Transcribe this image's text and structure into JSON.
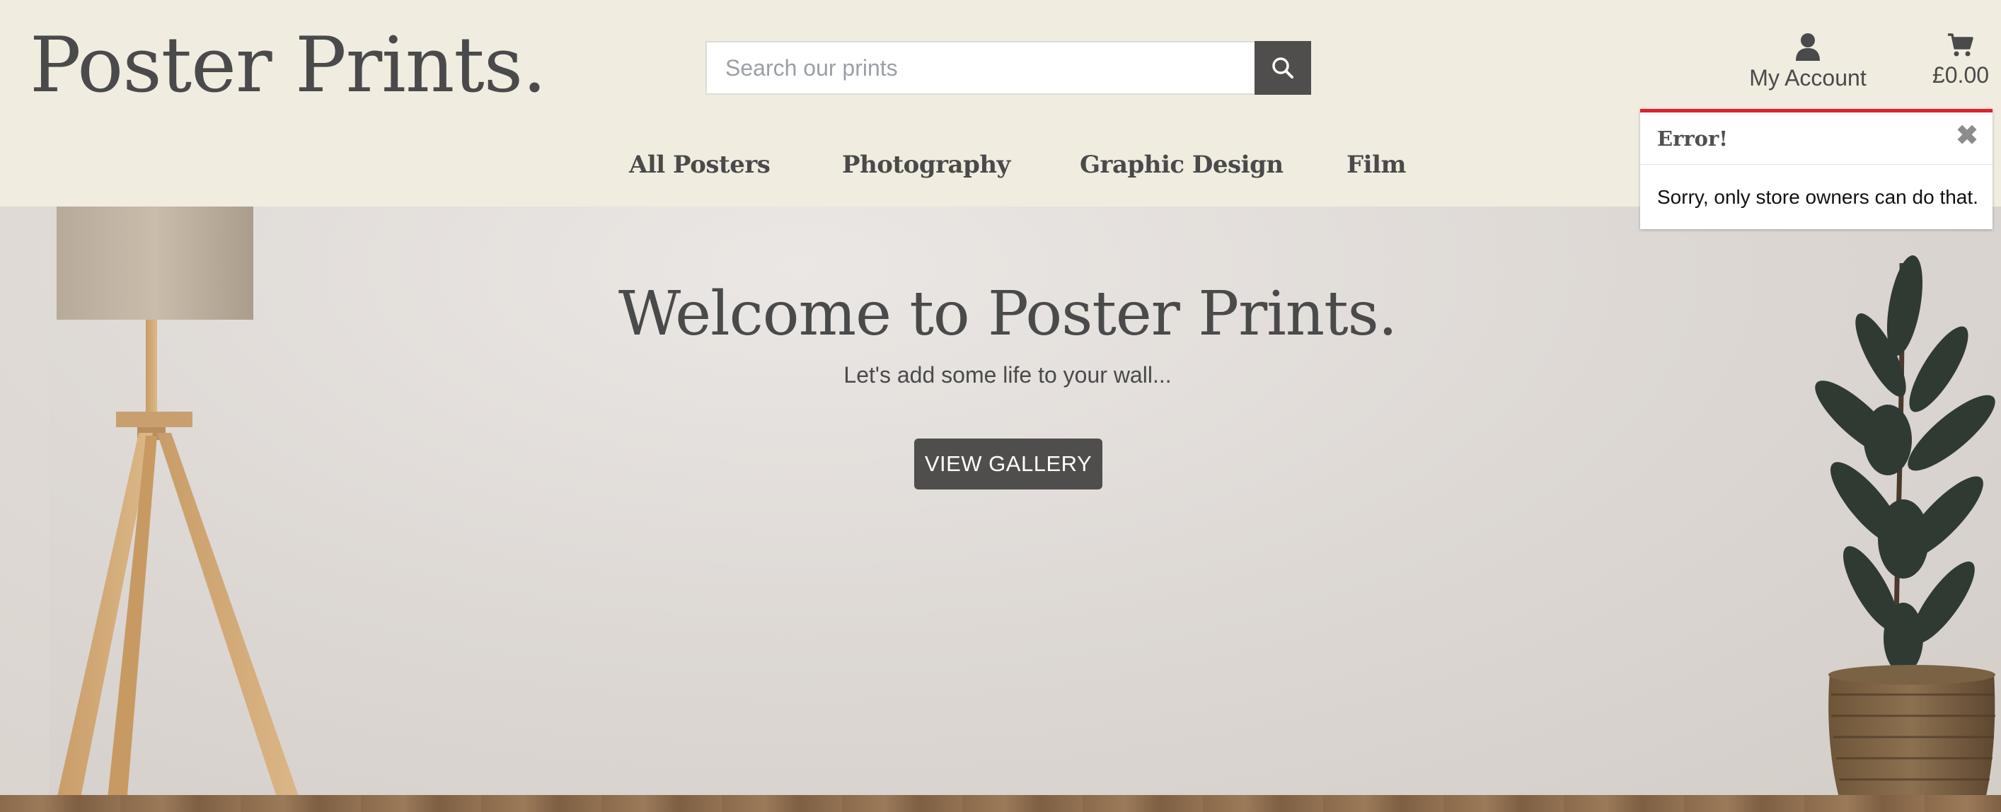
{
  "header": {
    "logo": "Poster Prints.",
    "search": {
      "placeholder": "Search our prints",
      "button_icon": "search-icon"
    },
    "account": {
      "icon": "user-icon",
      "label": "My Account"
    },
    "cart": {
      "icon": "cart-icon",
      "total": "£0.00"
    }
  },
  "nav": {
    "items": [
      {
        "label": "All Posters"
      },
      {
        "label": "Photography"
      },
      {
        "label": "Graphic Design"
      },
      {
        "label": "Film"
      }
    ]
  },
  "hero": {
    "title": "Welcome to Poster Prints.",
    "subtitle": "Let's add some life to your wall...",
    "button_label": "VIEW GALLERY"
  },
  "toast": {
    "title": "Error!",
    "close_icon": "close-icon",
    "message": "Sorry, only store owners can do that.",
    "accent_color": "#d9232f"
  },
  "colors": {
    "header_bg": "#f0ece0",
    "text": "#4a4a4a",
    "button_bg": "#4f4e4c"
  }
}
